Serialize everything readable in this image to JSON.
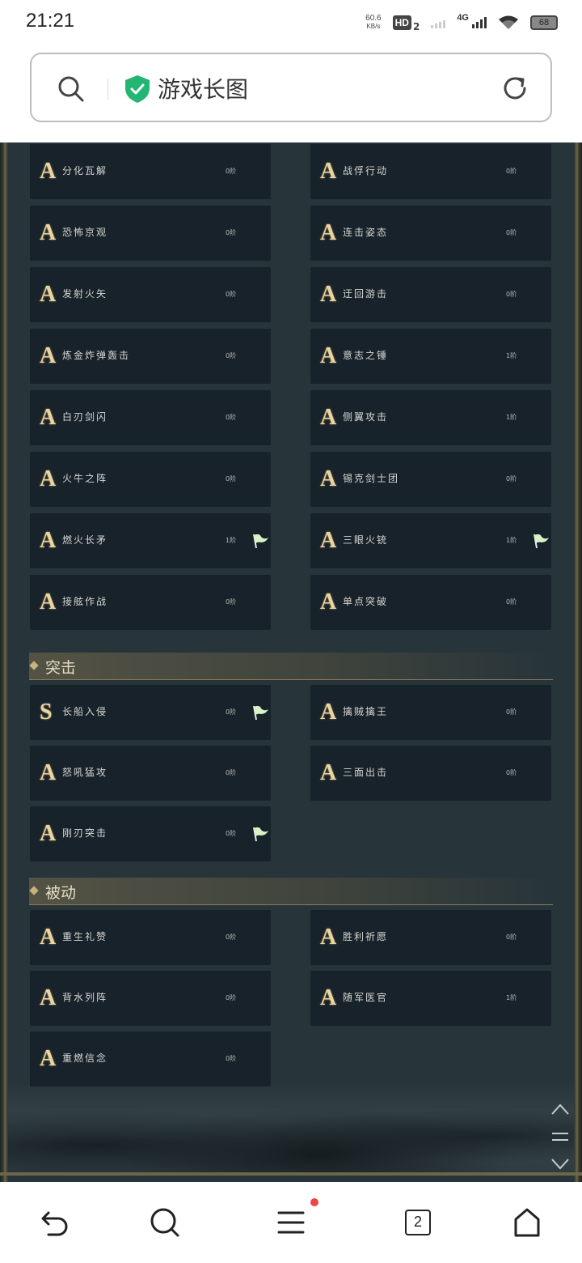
{
  "status_bar": {
    "time": "21:21",
    "net_speed_value": "60.6",
    "net_speed_unit": "KB/s",
    "hd_label": "HD",
    "hd_sub": "2",
    "network": "4G",
    "battery": "68"
  },
  "browser": {
    "search_title": "游戏长图"
  },
  "cards": [
    {
      "grade": "A",
      "name": "分化瓦解",
      "level": "0阶",
      "flag": false
    },
    {
      "grade": "A",
      "name": "战俘行动",
      "level": "0阶",
      "flag": false
    },
    {
      "grade": "A",
      "name": "恐怖京观",
      "level": "0阶",
      "flag": false
    },
    {
      "grade": "A",
      "name": "连击姿态",
      "level": "0阶",
      "flag": false
    },
    {
      "grade": "A",
      "name": "发射火矢",
      "level": "0阶",
      "flag": false
    },
    {
      "grade": "A",
      "name": "迂回游击",
      "level": "0阶",
      "flag": false
    },
    {
      "grade": "A",
      "name": "炼金炸弹轰击",
      "level": "0阶",
      "flag": false
    },
    {
      "grade": "A",
      "name": "意志之锤",
      "level": "1阶",
      "flag": false
    },
    {
      "grade": "A",
      "name": "白刃剑闪",
      "level": "0阶",
      "flag": false
    },
    {
      "grade": "A",
      "name": "侧翼攻击",
      "level": "1阶",
      "flag": false
    },
    {
      "grade": "A",
      "name": "火牛之阵",
      "level": "0阶",
      "flag": false
    },
    {
      "grade": "A",
      "name": "锡克剑士团",
      "level": "0阶",
      "flag": false
    },
    {
      "grade": "A",
      "name": "燃火长矛",
      "level": "1阶",
      "flag": true
    },
    {
      "grade": "A",
      "name": "三眼火铳",
      "level": "1阶",
      "flag": true
    },
    {
      "grade": "A",
      "name": "接舷作战",
      "level": "0阶",
      "flag": false
    },
    {
      "grade": "A",
      "name": "单点突破",
      "level": "0阶",
      "flag": false
    }
  ],
  "sections": [
    {
      "title": "突击",
      "cards": [
        {
          "grade": "S",
          "name": "长船入侵",
          "level": "0阶",
          "flag": true
        },
        {
          "grade": "A",
          "name": "擒贼擒王",
          "level": "0阶",
          "flag": false
        },
        {
          "grade": "A",
          "name": "怒吼猛攻",
          "level": "0阶",
          "flag": false
        },
        {
          "grade": "A",
          "name": "三面出击",
          "level": "0阶",
          "flag": false
        },
        {
          "grade": "A",
          "name": "刚刃突击",
          "level": "0阶",
          "flag": true
        }
      ]
    },
    {
      "title": "被动",
      "cards": [
        {
          "grade": "A",
          "name": "重生礼赞",
          "level": "0阶",
          "flag": false
        },
        {
          "grade": "A",
          "name": "胜利祈愿",
          "level": "0阶",
          "flag": false
        },
        {
          "grade": "A",
          "name": "背水列阵",
          "level": "0阶",
          "flag": false
        },
        {
          "grade": "A",
          "name": "随军医官",
          "level": "1阶",
          "flag": false
        },
        {
          "grade": "A",
          "name": "重燃信念",
          "level": "0阶",
          "flag": false
        }
      ]
    }
  ],
  "bottom_nav": {
    "tabs_count": "2"
  },
  "colors": {
    "background": "#27343a",
    "card": "#18222a",
    "grade_gold": "#e8d4a4",
    "notification_dot": "#ef4444"
  },
  "icons": [
    "search-icon",
    "shield-check-icon",
    "refresh-icon",
    "flag-icon",
    "scroll-up-icon",
    "scroll-menu-icon",
    "scroll-down-icon",
    "back-icon",
    "search-nav-icon",
    "menu-icon",
    "tabs-icon",
    "home-icon"
  ]
}
